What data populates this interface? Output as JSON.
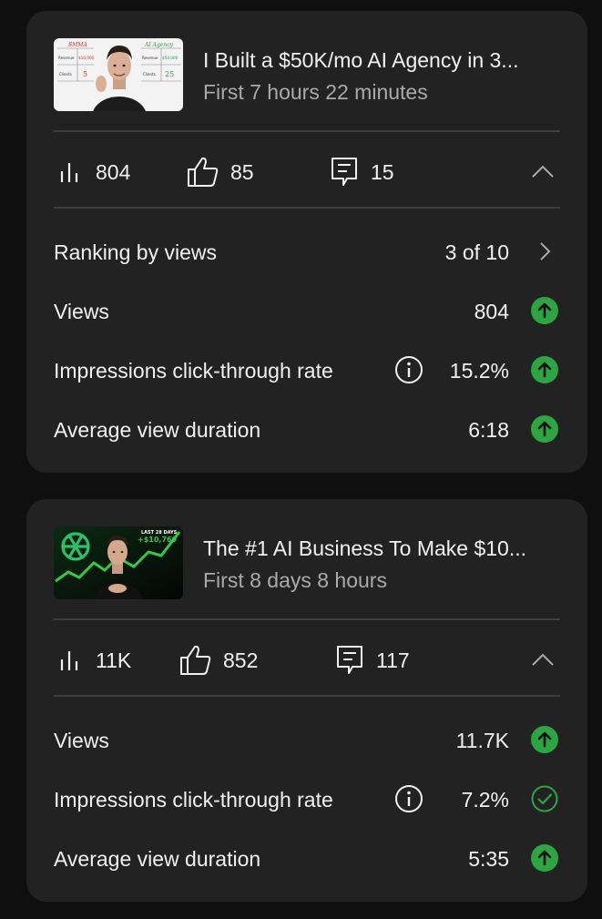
{
  "videos": [
    {
      "title": "I Built a $50K/mo AI Agency in 3...",
      "subtitle": "First 7 hours 22 minutes",
      "thumbnail": {
        "left_heading": "SMMA",
        "right_heading": "AI Agency",
        "left_revenue_label": "Revenue",
        "left_revenue": "$10,000",
        "right_revenue_label": "Revenue",
        "right_revenue": "$50,000",
        "left_clients_label": "Clients",
        "left_clients": "5",
        "right_clients_label": "Clients",
        "right_clients": "25"
      },
      "stats": {
        "views": "804",
        "likes": "85",
        "comments": "15"
      },
      "ranking": {
        "label": "Ranking by views",
        "value": "3 of 10"
      },
      "metrics": [
        {
          "label": "Views",
          "value": "804",
          "status": "up-arrow-icon"
        },
        {
          "label": "Impressions click-through rate",
          "value": "15.2%",
          "status": "up-arrow-icon"
        },
        {
          "label": "Average view duration",
          "value": "6:18",
          "status": "up-arrow-icon"
        }
      ]
    },
    {
      "title": "The #1 AI Business To Make $10...",
      "subtitle": "First 8 days 8 hours",
      "thumbnail": {
        "badge_top": "LAST 28 DAYS",
        "badge_amount": "+$10,769"
      },
      "stats": {
        "views": "11K",
        "likes": "852",
        "comments": "117"
      },
      "metrics": [
        {
          "label": "Views",
          "value": "11.7K",
          "status": "up-arrow-icon"
        },
        {
          "label": "Impressions click-through rate",
          "value": "7.2%",
          "status": "check-circle-icon"
        },
        {
          "label": "Average view duration",
          "value": "5:35",
          "status": "up-arrow-icon"
        }
      ]
    }
  ],
  "colors": {
    "background": "#0f0f0f",
    "card": "#222222",
    "divider": "#3d3d3d",
    "text_primary": "#f1f1f1",
    "text_secondary": "#aaaaaa",
    "positive_green": "#2ba640"
  }
}
